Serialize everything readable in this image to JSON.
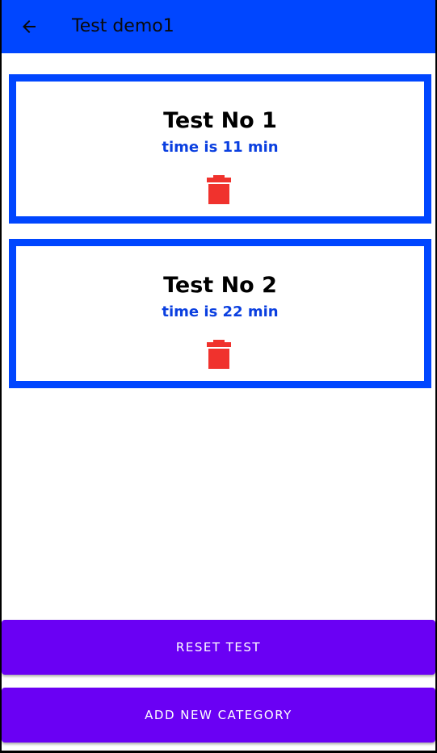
{
  "appbar": {
    "title": "Test demo1",
    "back_icon": "arrow-back-icon",
    "color": "#0046ff"
  },
  "tests": [
    {
      "title": "Test No 1",
      "time": "time is 11 min",
      "delete_icon": "trash-icon"
    },
    {
      "title": "Test No 2",
      "time": "time is 22 min",
      "delete_icon": "trash-icon"
    }
  ],
  "buttons": {
    "reset_label": "RESET TEST",
    "add_category_label": "ADD NEW CATEGORY"
  },
  "colors": {
    "card_border": "#0046ff",
    "time_text": "#0a3fe0",
    "delete": "#f0322d",
    "button": "#6a00f4"
  }
}
